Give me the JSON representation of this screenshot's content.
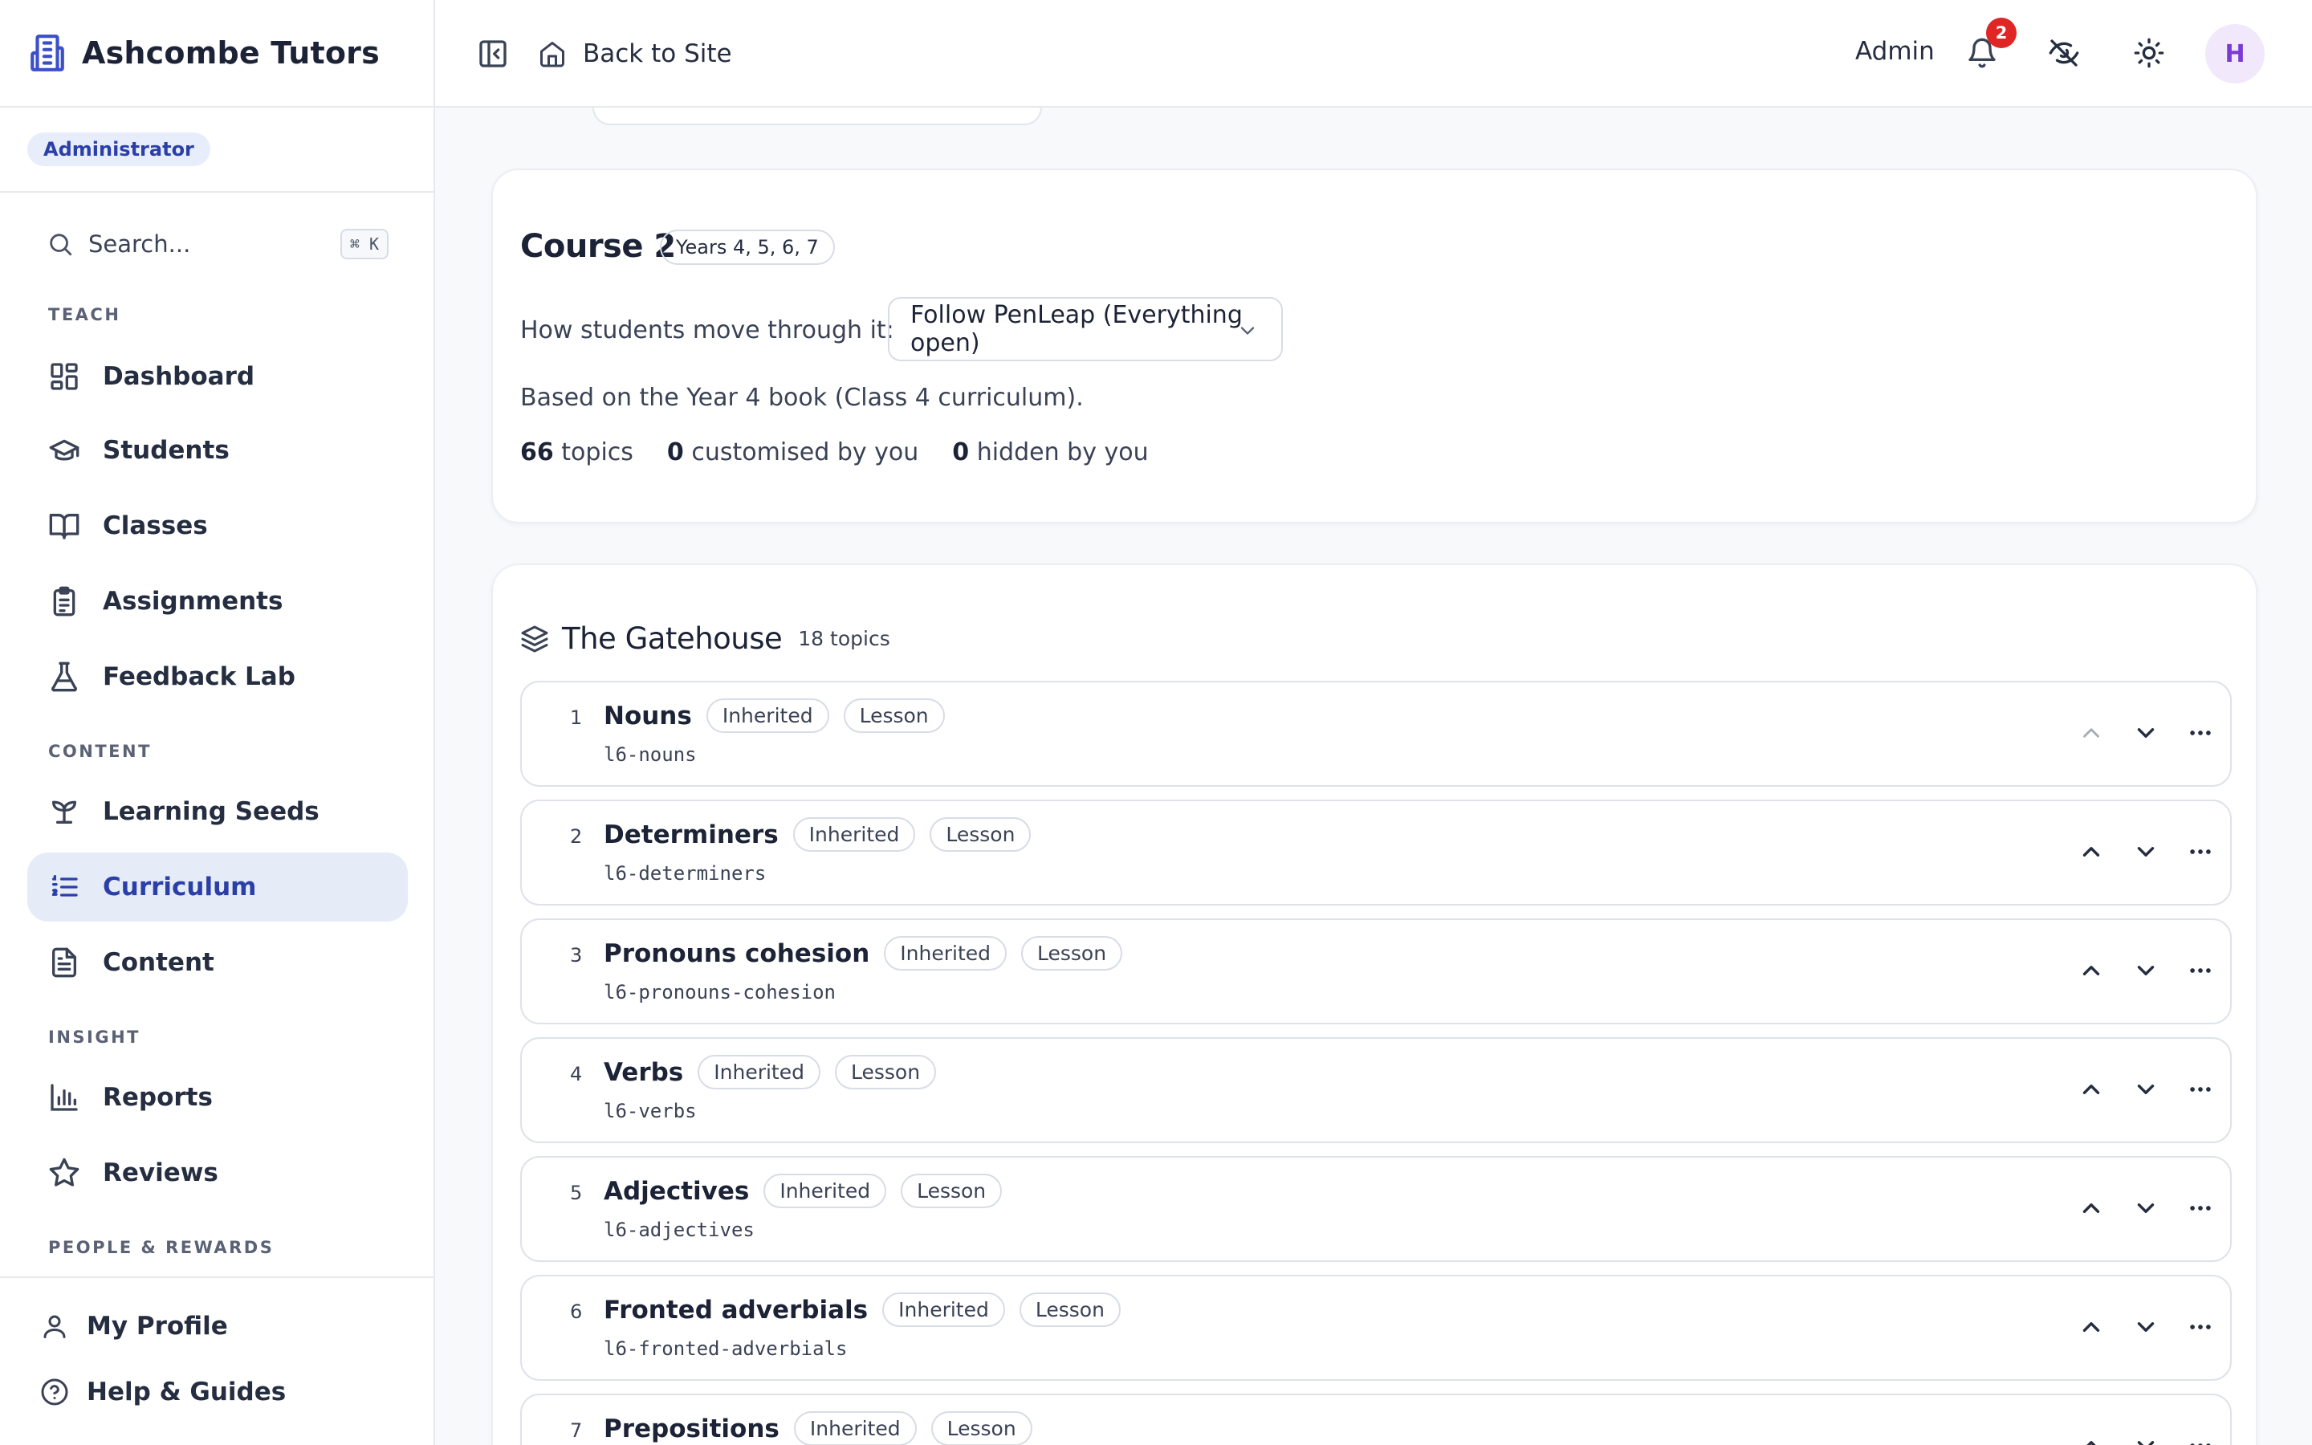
{
  "brand": {
    "name": "Ashcombe Tutors"
  },
  "role": {
    "label": "Administrator"
  },
  "search": {
    "label": "Search...",
    "shortcut": "⌘ K"
  },
  "sidebar": {
    "sections": {
      "teach": "TEACH",
      "content": "CONTENT",
      "insight": "INSIGHT",
      "people": "PEOPLE & REWARDS"
    },
    "items": {
      "dashboard": "Dashboard",
      "students": "Students",
      "classes": "Classes",
      "assignments": "Assignments",
      "feedback_lab": "Feedback Lab",
      "learning_seeds": "Learning Seeds",
      "curriculum": "Curriculum",
      "content": "Content",
      "reports": "Reports",
      "reviews": "Reviews"
    },
    "bottom": {
      "my_profile": "My Profile",
      "help": "Help & Guides"
    },
    "active": "curriculum"
  },
  "topbar": {
    "back_label": "Back to Site",
    "admin_label": "Admin",
    "notification_count": "2",
    "avatar_initial": "H"
  },
  "course": {
    "title": "Course 2",
    "years": "Years 4, 5, 6, 7",
    "move_label": "How students move through it:",
    "move_value": "Follow PenLeap (Everything open)",
    "based_on": "Based on the Year 4 book (Class 4 curriculum).",
    "stats": {
      "topics_count": "66",
      "topics_label": "topics",
      "customised_count": "0",
      "customised_label": "customised by you",
      "hidden_count": "0",
      "hidden_label": "hidden by you"
    }
  },
  "unit": {
    "title": "The Gatehouse",
    "count": "18 topics",
    "topics": [
      {
        "num": "1",
        "name": "Nouns",
        "status": "Inherited",
        "kind": "Lesson",
        "slug": "l6-nouns"
      },
      {
        "num": "2",
        "name": "Determiners",
        "status": "Inherited",
        "kind": "Lesson",
        "slug": "l6-determiners"
      },
      {
        "num": "3",
        "name": "Pronouns cohesion",
        "status": "Inherited",
        "kind": "Lesson",
        "slug": "l6-pronouns-cohesion"
      },
      {
        "num": "4",
        "name": "Verbs",
        "status": "Inherited",
        "kind": "Lesson",
        "slug": "l6-verbs"
      },
      {
        "num": "5",
        "name": "Adjectives",
        "status": "Inherited",
        "kind": "Lesson",
        "slug": "l6-adjectives"
      },
      {
        "num": "6",
        "name": "Fronted adverbials",
        "status": "Inherited",
        "kind": "Lesson",
        "slug": "l6-fronted-adverbials"
      },
      {
        "num": "7",
        "name": "Prepositions",
        "status": "Inherited",
        "kind": "Lesson",
        "slug": ""
      }
    ]
  },
  "colors": {
    "accent": "#2b3fa8",
    "active_bg": "#e6ebf8",
    "badge_red": "#e02525",
    "avatar_bg": "#f1e8fb",
    "avatar_fg": "#7a3ad4"
  }
}
